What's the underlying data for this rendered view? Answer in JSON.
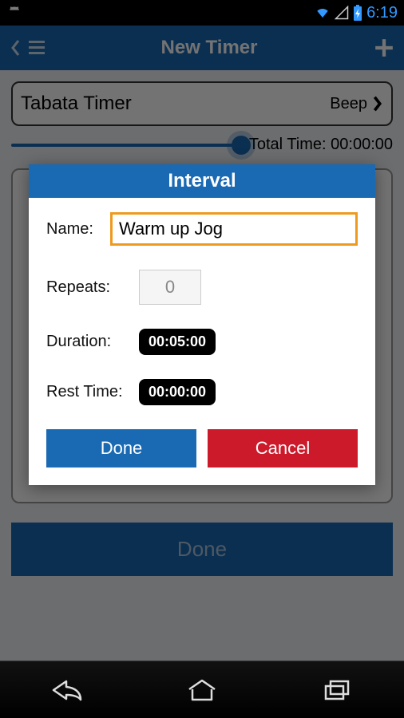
{
  "status": {
    "time": "6:19"
  },
  "appbar": {
    "title": "New Timer"
  },
  "timer": {
    "name": "Tabata Timer",
    "sound": "Beep",
    "total_label": "Total Time:",
    "total_value": "00:00:00"
  },
  "bg_done": "Done",
  "dialog": {
    "title": "Interval",
    "name_label": "Name:",
    "name_value": "Warm up Jog",
    "repeats_label": "Repeats:",
    "repeats_value": "0",
    "duration_label": "Duration:",
    "duration_value": "00:05:00",
    "rest_label": "Rest Time:",
    "rest_value": "00:00:00",
    "done": "Done",
    "cancel": "Cancel"
  }
}
